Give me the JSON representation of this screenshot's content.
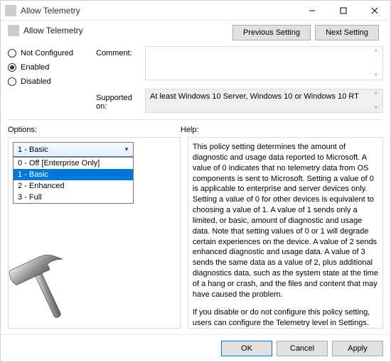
{
  "window": {
    "title": "Allow Telemetry"
  },
  "header": {
    "title": "Allow Telemetry",
    "prev_label": "Previous Setting",
    "next_label": "Next Setting"
  },
  "state": {
    "not_configured_label": "Not Configured",
    "enabled_label": "Enabled",
    "disabled_label": "Disabled",
    "selected": "enabled"
  },
  "fields": {
    "comment_label": "Comment:",
    "comment_value": "",
    "supported_label": "Supported on:",
    "supported_value": "At least Windows 10 Server, Windows 10 or Windows 10 RT"
  },
  "options": {
    "section_label": "Options:",
    "combo_value": "1 - Basic",
    "dropdown_items": [
      "0 - Off [Enterprise Only]",
      "1 - Basic",
      "2 - Enhanced",
      "3 - Full"
    ],
    "dropdown_selected_index": 1
  },
  "help": {
    "section_label": "Help:",
    "para1": "This policy setting determines the amount of diagnostic and usage data reported to Microsoft. A value of 0 indicates that no telemetry data from OS components is sent to Microsoft. Setting a value of 0 is applicable to enterprise and server devices only. Setting a value of 0 for other devices is equivalent to choosing a value of 1. A value of 1 sends only a limited, or basic, amount of diagnostic and usage data. Note that setting values of 0 or 1 will degrade certain experiences on the device. A value of 2 sends enhanced diagnostic and usage data. A value of 3 sends the same data as a value of 2, plus additional diagnostics data, such as the system state at the time of a hang or crash, and the files and content that may have caused the problem.",
    "para2": "If you disable or do not configure this policy setting, users can configure the Telemetry level in Settings."
  },
  "footer": {
    "ok_label": "OK",
    "cancel_label": "Cancel",
    "apply_label": "Apply"
  }
}
